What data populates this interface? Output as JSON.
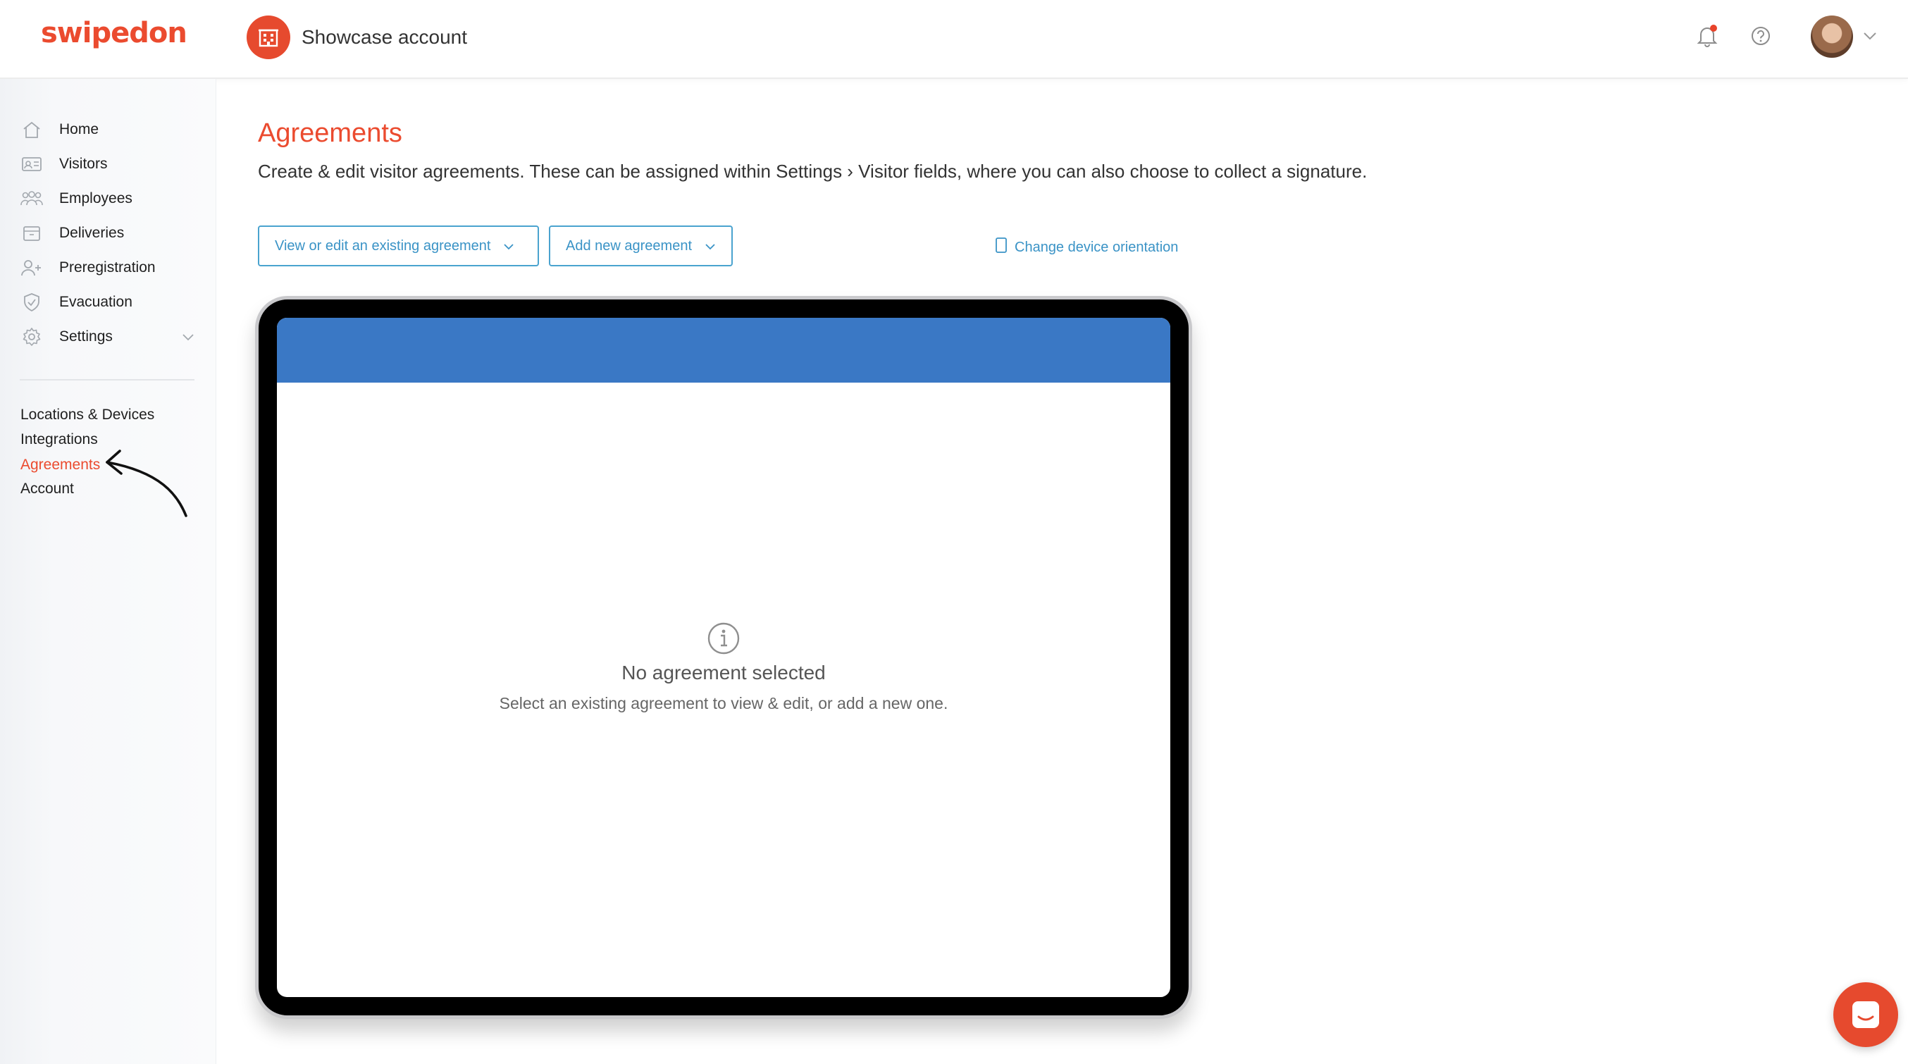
{
  "header": {
    "logo_text": "swipedon",
    "account_name": "Showcase account",
    "account_icon": "building-icon",
    "notification_icon": "bell-icon",
    "help_icon": "help-circle-icon",
    "avatar": "user-avatar",
    "brand_color": "#eb4b2f"
  },
  "sidebar": {
    "nav": [
      {
        "label": "Home",
        "icon": "home-icon"
      },
      {
        "label": "Visitors",
        "icon": "id-card-icon"
      },
      {
        "label": "Employees",
        "icon": "people-icon"
      },
      {
        "label": "Deliveries",
        "icon": "package-icon"
      },
      {
        "label": "Preregistration",
        "icon": "user-plus-icon"
      },
      {
        "label": "Evacuation",
        "icon": "shield-icon"
      },
      {
        "label": "Settings",
        "icon": "gear-icon"
      }
    ],
    "sub": [
      {
        "label": "Locations & Devices",
        "active": false
      },
      {
        "label": "Integrations",
        "active": false
      },
      {
        "label": "Agreements",
        "active": true
      },
      {
        "label": "Account",
        "active": false
      }
    ]
  },
  "main": {
    "title": "Agreements",
    "description": "Create & edit visitor agreements. These can be assigned within Settings › Visitor fields, where you can also choose to collect a signature.",
    "view_edit_button": "View or edit an existing agreement",
    "add_new_button": "Add new agreement",
    "orientation_link": "Change device orientation",
    "accent_color": "#3a93c6"
  },
  "preview": {
    "bar_color": "#3a78c5",
    "empty_title": "No agreement selected",
    "empty_subtitle": "Select an existing agreement to view & edit, or add a new one."
  },
  "chat": {
    "icon": "chat-icon"
  }
}
